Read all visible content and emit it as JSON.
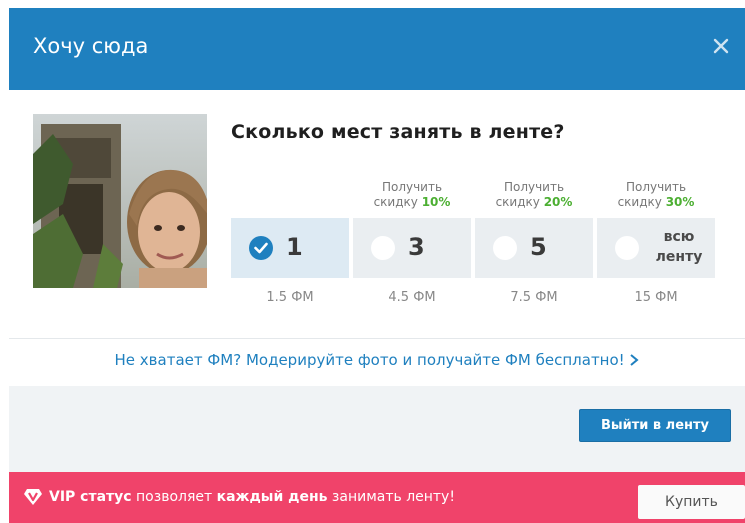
{
  "header": {
    "title": "Хочу сюда",
    "close_icon": "close-icon"
  },
  "question": "Сколько мест занять в ленте?",
  "options": [
    {
      "discount_prefix": "",
      "discount_line2": "",
      "discount_pct": "",
      "value": "1",
      "price": "1.5 ФМ",
      "selected": true
    },
    {
      "discount_prefix": "Получить",
      "discount_line2": "скидку ",
      "discount_pct": "10%",
      "value": "3",
      "price": "4.5 ФМ",
      "selected": false
    },
    {
      "discount_prefix": "Получить",
      "discount_line2": "скидку ",
      "discount_pct": "20%",
      "value": "5",
      "price": "7.5 ФМ",
      "selected": false
    },
    {
      "discount_prefix": "Получить",
      "discount_line2": "скидку ",
      "discount_pct": "30%",
      "value_line1": "всю",
      "value_line2": "ленту",
      "price": "15 ФМ",
      "selected": false
    }
  ],
  "moderate_link": "Не хватает ФМ? Модерируйте фото и получайте ФМ бесплатно!",
  "go_button": "Выйти в ленту",
  "vip": {
    "part1": "VIP статус",
    "part2": " позволяет ",
    "part3": "каждый день",
    "part4": " занимать ленту!",
    "buy_button": "Купить"
  },
  "colors": {
    "brand_blue": "#1f80bf",
    "vip_pink": "#f0436a",
    "discount_green": "#4caf32"
  }
}
